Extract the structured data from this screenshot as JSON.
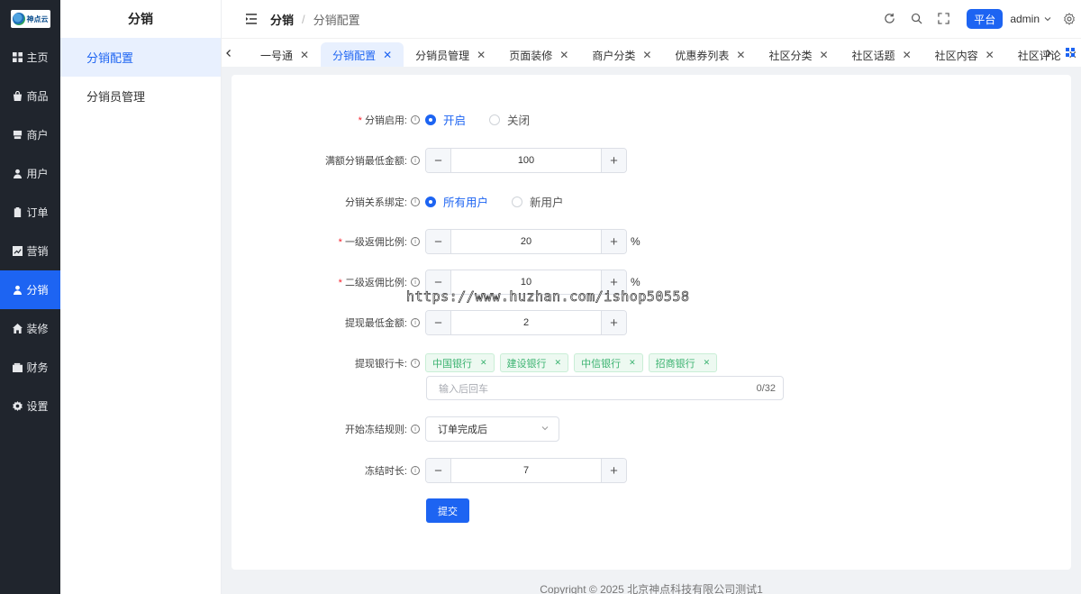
{
  "logo": {
    "text": "神点云"
  },
  "sidebar": {
    "items": [
      {
        "label": "主页",
        "icon": "grid-icon"
      },
      {
        "label": "商品",
        "icon": "bag-icon"
      },
      {
        "label": "商户",
        "icon": "store-icon"
      },
      {
        "label": "用户",
        "icon": "user-icon"
      },
      {
        "label": "订单",
        "icon": "clipboard-icon"
      },
      {
        "label": "营销",
        "icon": "chart-icon"
      },
      {
        "label": "分销",
        "icon": "share-user-icon",
        "active": true
      },
      {
        "label": "装修",
        "icon": "home-icon"
      },
      {
        "label": "财务",
        "icon": "wallet-icon"
      },
      {
        "label": "设置",
        "icon": "gear-icon"
      }
    ]
  },
  "submenu": {
    "title": "分销",
    "items": [
      {
        "label": "分销配置",
        "active": true
      },
      {
        "label": "分销员管理"
      }
    ]
  },
  "header": {
    "breadcrumb": [
      "分销",
      "分销配置"
    ],
    "platform_label": "平台",
    "user": "admin"
  },
  "tabs": [
    {
      "label": "一号通"
    },
    {
      "label": "分销配置",
      "active": true
    },
    {
      "label": "分销员管理"
    },
    {
      "label": "页面装修"
    },
    {
      "label": "商户分类"
    },
    {
      "label": "优惠券列表"
    },
    {
      "label": "社区分类"
    },
    {
      "label": "社区话题"
    },
    {
      "label": "社区内容"
    },
    {
      "label": "社区评论"
    }
  ],
  "form": {
    "enable": {
      "label": "分销启用:",
      "options": [
        "开启",
        "关闭"
      ],
      "selected": "开启"
    },
    "min_amount": {
      "label": "满额分销最低金额:",
      "value": "100"
    },
    "bind": {
      "label": "分销关系绑定:",
      "options": [
        "所有用户",
        "新用户"
      ],
      "selected": "所有用户"
    },
    "level1": {
      "label": "一级返佣比例:",
      "value": "20",
      "unit": "%"
    },
    "level2": {
      "label": "二级返佣比例:",
      "value": "10",
      "unit": "%"
    },
    "withdraw_min": {
      "label": "提现最低金额:",
      "value": "2"
    },
    "banks": {
      "label": "提现银行卡:",
      "tags": [
        "中国银行",
        "建设银行",
        "中信银行",
        "招商银行"
      ],
      "placeholder": "输入后回车",
      "counter": "0/32"
    },
    "freeze_rule": {
      "label": "开始冻结规则:",
      "value": "订单完成后"
    },
    "freeze_days": {
      "label": "冻结时长:",
      "value": "7"
    },
    "submit": "提交"
  },
  "watermark": "https://www.huzhan.com/ishop50558",
  "footer": "Copyright © 2025 北京神点科技有限公司测试1",
  "colors": {
    "primary": "#1d64f2",
    "sidebar_bg": "#20252d",
    "tag_green": "#3cb371"
  }
}
